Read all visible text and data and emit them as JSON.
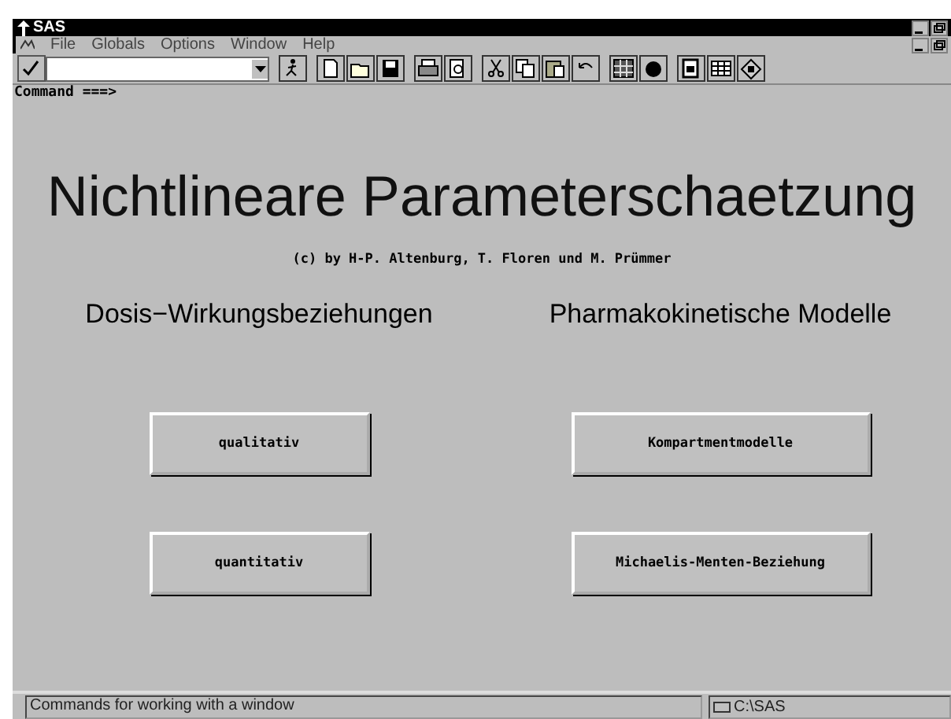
{
  "window": {
    "title": "SAS"
  },
  "menu": [
    "File",
    "Globals",
    "Options",
    "Window",
    "Help"
  ],
  "command": {
    "label": "Command ===>"
  },
  "main": {
    "title": "Nichtlineare Parameterschaetzung",
    "credits": "(c) by H-P. Altenburg, T. Floren und M. Prümmer",
    "sections": [
      {
        "heading": "Dosis−Wirkungsbeziehungen",
        "buttons": [
          "qualitativ",
          "quantitativ"
        ]
      },
      {
        "heading": "Pharmakokinetische Modelle",
        "buttons": [
          "Kompartmentmodelle",
          "Michaelis-Menten-Beziehung"
        ]
      }
    ]
  },
  "status_bar": {
    "message": "Commands for working with a window",
    "path": "C:\\SAS"
  }
}
